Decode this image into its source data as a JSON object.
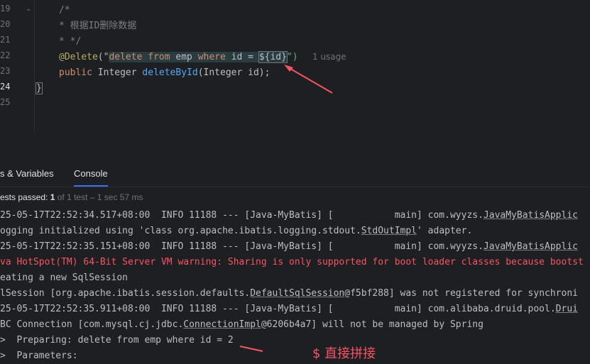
{
  "editor": {
    "line_numbers": [
      "19",
      "20",
      "21",
      "22",
      "23",
      "24",
      "25"
    ],
    "current_line": "24",
    "lines": {
      "l19": "/*",
      "l20": "* 根据ID删除数据",
      "l21": "* */",
      "l22_anno": "@Delete",
      "l22_open": "(\"",
      "l22_sql_a": "delete",
      "l22_sql_b": " from ",
      "l22_sql_c": "emp",
      "l22_sql_d": " where ",
      "l22_sql_e": "id = ",
      "l22_param": "${id}",
      "l22_close": "\")",
      "l23_kw": "public",
      "l23_type": " Integer ",
      "l23_fn": "deleteById",
      "l23_rest": "(Integer id);",
      "l24": "}"
    },
    "usage_hint": "1 usage"
  },
  "bottom_panel": {
    "tabs": [
      {
        "label": "s & Variables"
      },
      {
        "label": "Console"
      }
    ],
    "status": {
      "prefix": "ests passed: ",
      "count": "1",
      "suffix": " of 1 test – 1 sec 57 ms"
    }
  },
  "console": {
    "lines": [
      {
        "text": "25-05-17T22:52:34.517+08:00  INFO 11188 --- [Java-MyBatis] [           main] com.wyyzs.",
        "link": "JavaMyBatisApplic",
        "rest": "",
        "error": false
      },
      {
        "text": "ogging initialized using 'class org.apache.ibatis.logging.stdout.",
        "link": "StdOutImpl",
        "rest": "' adapter.",
        "error": false
      },
      {
        "text": "25-05-17T22:52:35.151+08:00  INFO 11188 --- [Java-MyBatis] [           main] com.wyyzs.",
        "link": "JavaMyBatisApplic",
        "rest": "",
        "error": false
      },
      {
        "text": "va HotSpot(TM) 64-Bit Server VM warning: Sharing is only supported for boot loader classes because bootst",
        "link": "",
        "rest": "",
        "error": true
      },
      {
        "text": "eating a new SqlSession",
        "link": "",
        "rest": "",
        "error": false
      },
      {
        "text": "lSession [org.apache.ibatis.session.defaults.",
        "link": "DefaultSqlSession",
        "rest": "@f5bf288] was not registered for synchroni",
        "error": false
      },
      {
        "text": "25-05-17T22:52:35.911+08:00  INFO 11188 --- [Java-MyBatis] [           main] com.alibaba.druid.pool.",
        "link": "Drui",
        "rest": "",
        "error": false
      },
      {
        "text": "BC Connection [com.mysql.cj.jdbc.",
        "link": "ConnectionImpl",
        "rest": "@6206b4a7] will not be managed by Spring",
        "error": false
      },
      {
        "text": ">  Preparing: delete from emp where id = 2",
        "link": "",
        "rest": "",
        "error": false
      },
      {
        "text": ">  Parameters:",
        "link": "",
        "rest": "",
        "error": false
      }
    ]
  },
  "annotation": {
    "label": "$ 直接拼接",
    "color": "#f75464"
  },
  "colors": {
    "background": "#1e1f22",
    "tab_underline": "#3574f0",
    "error_text": "#f75464",
    "sql_highlight": "#293c40"
  }
}
